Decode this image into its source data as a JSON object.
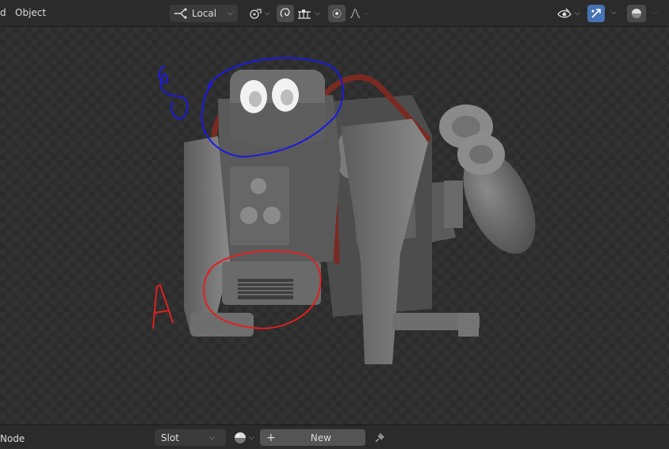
{
  "header": {
    "menu_partial": "d",
    "menu_object": "Object",
    "transform_orientation": "Local",
    "icons": {
      "orientation": "transform-orientation-icon",
      "pivot": "pivot-point-icon",
      "snap": "snap-magnet-icon",
      "snap_target": "snap-grid-icon",
      "proportional": "proportional-edit-icon",
      "falloff": "falloff-curve-icon",
      "visibility": "eye-visibility-icon",
      "gizmo": "gizmo-toggle-icon",
      "overlay": "overlay-sphere-icon"
    }
  },
  "annotations": {
    "letter_a": "A",
    "colors": {
      "red": "#e02020",
      "blue": "#1a1adf"
    }
  },
  "footer": {
    "editor_label": "Node",
    "slot_label": "Slot",
    "new_label": "New",
    "plus": "+",
    "icons": {
      "material": "material-sphere-icon",
      "pin": "pin-icon"
    }
  },
  "colors": {
    "header_bg": "#2b2b2b",
    "button_bg": "#3a3a3a",
    "active_blue": "#4772b3",
    "robot_gray": "#7a7a7a",
    "robot_rust": "#7a2a22"
  }
}
